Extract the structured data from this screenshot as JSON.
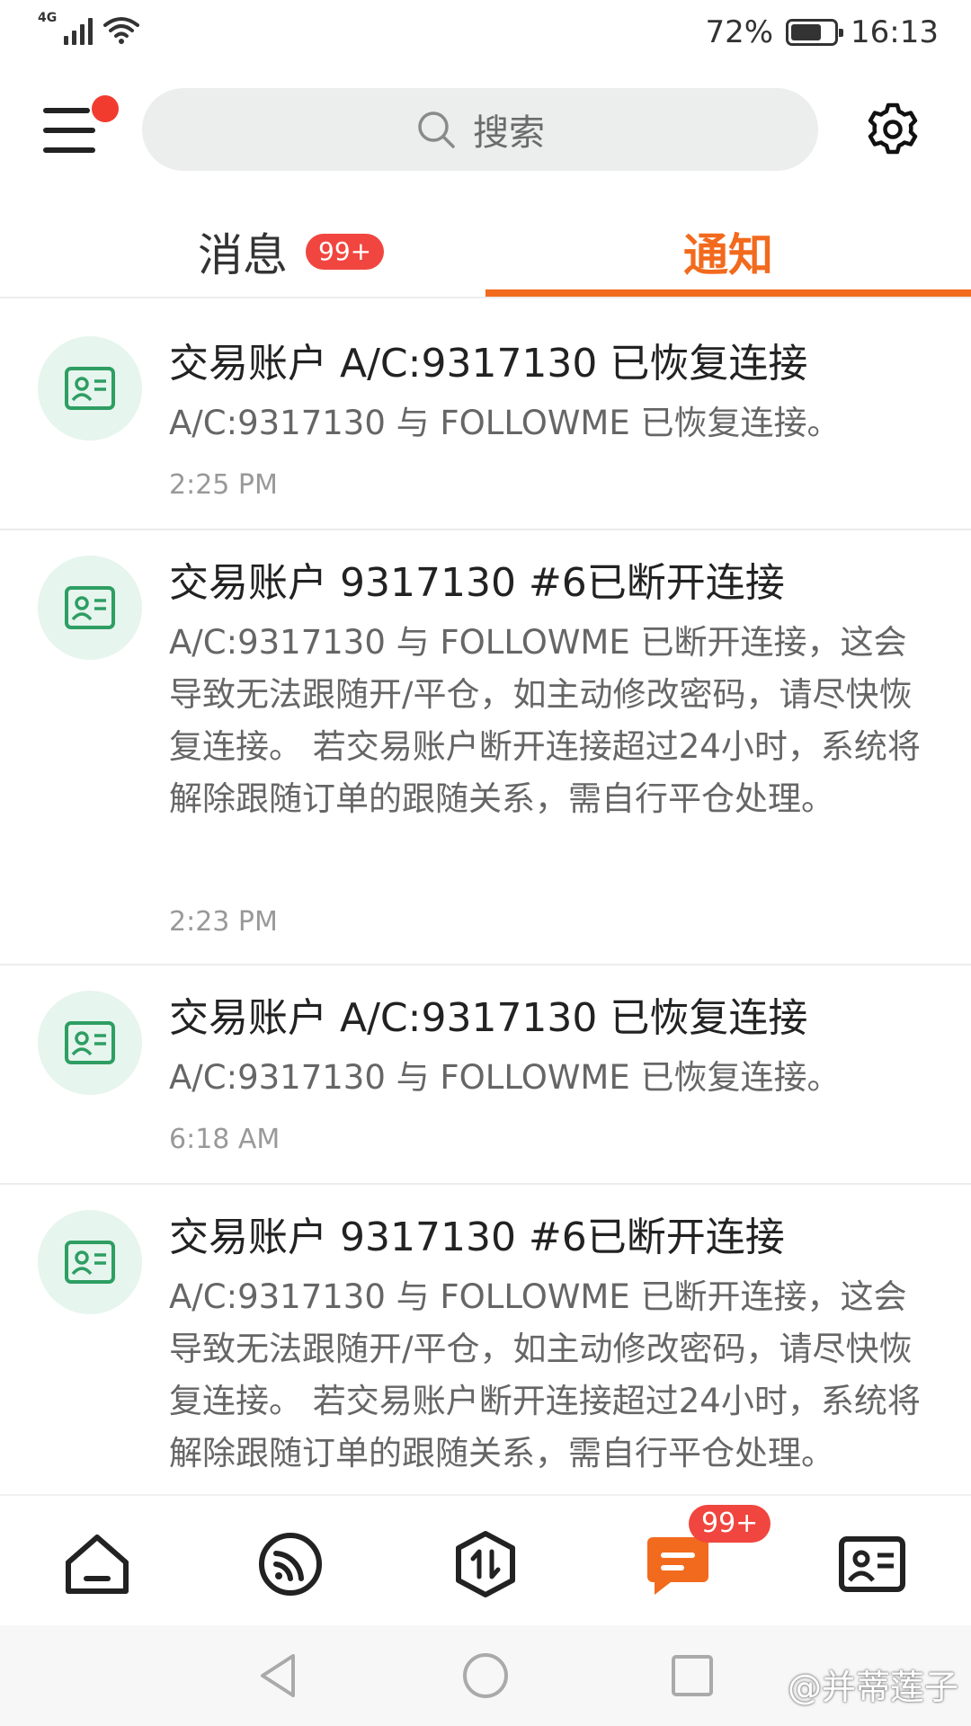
{
  "status_bar": {
    "network": "4G",
    "battery_percent": "72%",
    "battery_level": 0.72,
    "time": "16:13"
  },
  "header": {
    "search_placeholder": "搜索",
    "menu_has_notification": true
  },
  "tabs": [
    {
      "label": "消息",
      "badge": "99+",
      "active": false
    },
    {
      "label": "通知",
      "active": true
    }
  ],
  "notifications": [
    {
      "title": "交易账户 A/C:9317130 已恢复连接",
      "body": "A/C:9317130 与 FOLLOWME 已恢复连接。",
      "time": "2:25 PM",
      "icon": "account-card-icon"
    },
    {
      "title": "交易账户 9317130 #6已断开连接",
      "body": "A/C:9317130 与 FOLLOWME 已断开连接，这会导致无法跟随开/平仓，如主动修改密码，请尽快恢复连接。 若交易账户断开连接超过24小时，系统将解除跟随订单的跟随关系，需自行平仓处理。",
      "time": "2:23 PM",
      "icon": "account-card-icon"
    },
    {
      "title": "交易账户 A/C:9317130 已恢复连接",
      "body": "A/C:9317130 与 FOLLOWME 已恢复连接。",
      "time": "6:18 AM",
      "icon": "account-card-icon"
    },
    {
      "title": "交易账户 9317130 #6已断开连接",
      "body": "A/C:9317130 与 FOLLOWME 已断开连接，这会导致无法跟随开/平仓，如主动修改密码，请尽快恢复连接。 若交易账户断开连接超过24小时，系统将解除跟随订单的跟随关系，需自行平仓处理。",
      "time": "",
      "icon": "account-card-icon"
    }
  ],
  "bottom_nav": {
    "items": [
      "home-icon",
      "feed-icon",
      "trade-icon",
      "messages-icon",
      "account-icon"
    ],
    "messages_badge": "99+",
    "active": "messages-icon"
  },
  "watermark": "@并蒂莲子",
  "colors": {
    "accent": "#f26a1d",
    "badge": "#f0463f",
    "icon_green": "#2e9e63",
    "icon_bg": "#e6f5ed"
  }
}
